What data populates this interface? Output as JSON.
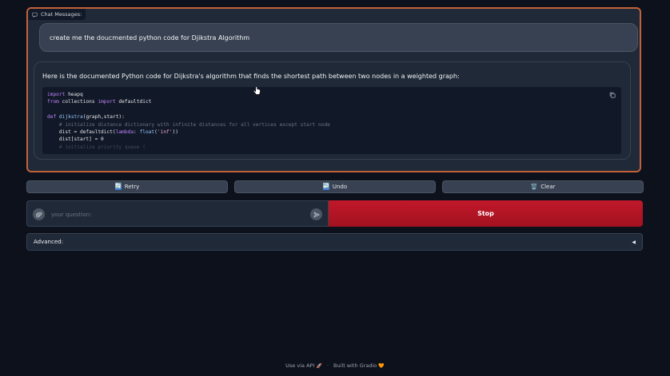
{
  "chat": {
    "label": "Chat Messages:",
    "user_message": "create me the doucmented python code for Djikstra Algorithm",
    "bot_intro": "Here is the documented Python code for Dijkstra's algorithm that finds the shortest path between two nodes in a weighted graph:",
    "code_lines": [
      [
        {
          "t": "import",
          "c": "kw"
        },
        {
          "t": " heapq",
          "c": ""
        }
      ],
      [
        {
          "t": "from",
          "c": "kw"
        },
        {
          "t": " collections ",
          "c": ""
        },
        {
          "t": "import",
          "c": "kw"
        },
        {
          "t": " defaultdict",
          "c": ""
        }
      ],
      [
        {
          "t": "",
          "c": ""
        }
      ],
      [
        {
          "t": "def",
          "c": "kw"
        },
        {
          "t": " ",
          "c": ""
        },
        {
          "t": "dijkstra",
          "c": "fn"
        },
        {
          "t": "(graph,start):",
          "c": ""
        }
      ],
      [
        {
          "t": "    ",
          "c": ""
        },
        {
          "t": "# initialize distance dictionary with infinite distances for all vertices except start node",
          "c": "cm"
        }
      ],
      [
        {
          "t": "    dist = defaultdict(",
          "c": ""
        },
        {
          "t": "lambda",
          "c": "kw"
        },
        {
          "t": ": ",
          "c": ""
        },
        {
          "t": "float",
          "c": "fn"
        },
        {
          "t": "(",
          "c": ""
        },
        {
          "t": "'inf'",
          "c": "str"
        },
        {
          "t": "))",
          "c": ""
        }
      ],
      [
        {
          "t": "    dist[start] = 0",
          "c": ""
        }
      ],
      [
        {
          "t": "    ",
          "c": ""
        },
        {
          "t": "# initialize priority queue (",
          "c": "cm"
        }
      ]
    ]
  },
  "buttons": {
    "retry": {
      "icon": "🔄",
      "label": "Retry"
    },
    "undo": {
      "icon": "↩️",
      "label": "Undo"
    },
    "clear": {
      "icon": "🗑️",
      "label": "Clear"
    }
  },
  "input": {
    "placeholder": "your question:",
    "value": ""
  },
  "stop": {
    "label": "Stop"
  },
  "advanced": {
    "label": "Advanced:",
    "arrow": "◀"
  },
  "footer": {
    "api_label": "Use via API",
    "api_icon": "🚀",
    "separator": "·",
    "built_label": "Built with Gradio",
    "built_icon": "🧡"
  },
  "colors": {
    "accent_border": "#c2623b",
    "stop_button": "#b9172a",
    "background": "#0c111c"
  }
}
